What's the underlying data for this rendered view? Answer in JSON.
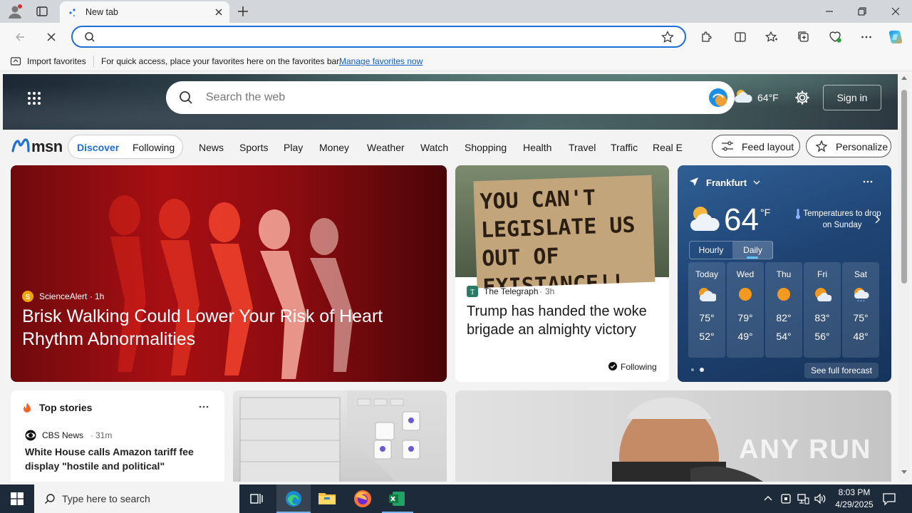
{
  "browser": {
    "tab_title": "New tab",
    "address_value": "",
    "favbar": {
      "import_label": "Import favorites",
      "hint": "For quick access, place your favorites here on the favorites bar.",
      "manage_link": "Manage favorites now"
    }
  },
  "msn": {
    "search_placeholder": "Search the web",
    "temp_header": "64°F",
    "sign_in": "Sign in",
    "logo": "msn",
    "tabs": [
      {
        "label": "Discover"
      },
      {
        "label": "Following"
      }
    ],
    "categories": [
      "News",
      "Sports",
      "Play",
      "Money",
      "Weather",
      "Watch",
      "Shopping",
      "Health",
      "Travel",
      "Traffic",
      "Real E"
    ],
    "feed_layout": "Feed layout",
    "personalize": "Personalize"
  },
  "hero_article": {
    "source": "ScienceAlert",
    "age": "1h",
    "title": "Brisk Walking Could Lower Your Risk of Heart Rhythm Abnormalities"
  },
  "second_article": {
    "sign_text": "YOU CAN'T LEGISLATE US OUT OF EXISTANCE!!",
    "source": "The Telegraph",
    "age": "3h",
    "title": "Trump has handed the woke brigade an almighty victory",
    "following": "Following"
  },
  "weather": {
    "city": "Frankfurt",
    "temp": "64",
    "unit": "°F",
    "alert": "Temperatures to drop on Sunday",
    "tabs": [
      "Hourly",
      "Daily"
    ],
    "days": [
      {
        "day": "Today",
        "high": "75°",
        "low": "52°",
        "icon": "partly-sunny"
      },
      {
        "day": "Wed",
        "high": "79°",
        "low": "49°",
        "icon": "sunny"
      },
      {
        "day": "Thu",
        "high": "82°",
        "low": "54°",
        "icon": "sunny"
      },
      {
        "day": "Fri",
        "high": "83°",
        "low": "56°",
        "icon": "partly-sunny"
      },
      {
        "day": "Sat",
        "high": "75°",
        "low": "48°",
        "icon": "rain-sun"
      }
    ],
    "see_full": "See full forecast"
  },
  "top_stories": {
    "title": "Top stories",
    "source": "CBS News",
    "age": "31m",
    "headline": "White House calls Amazon tariff fee display \"hostile and political\""
  },
  "watermark": "ANY RUN",
  "taskbar": {
    "search_placeholder": "Type here to search",
    "time": "8:03 PM",
    "date": "4/29/2025"
  },
  "colors": {
    "accent": "#1f6fd8",
    "taskbar": "#1c2a3a",
    "hero_red": "#c7161a"
  }
}
